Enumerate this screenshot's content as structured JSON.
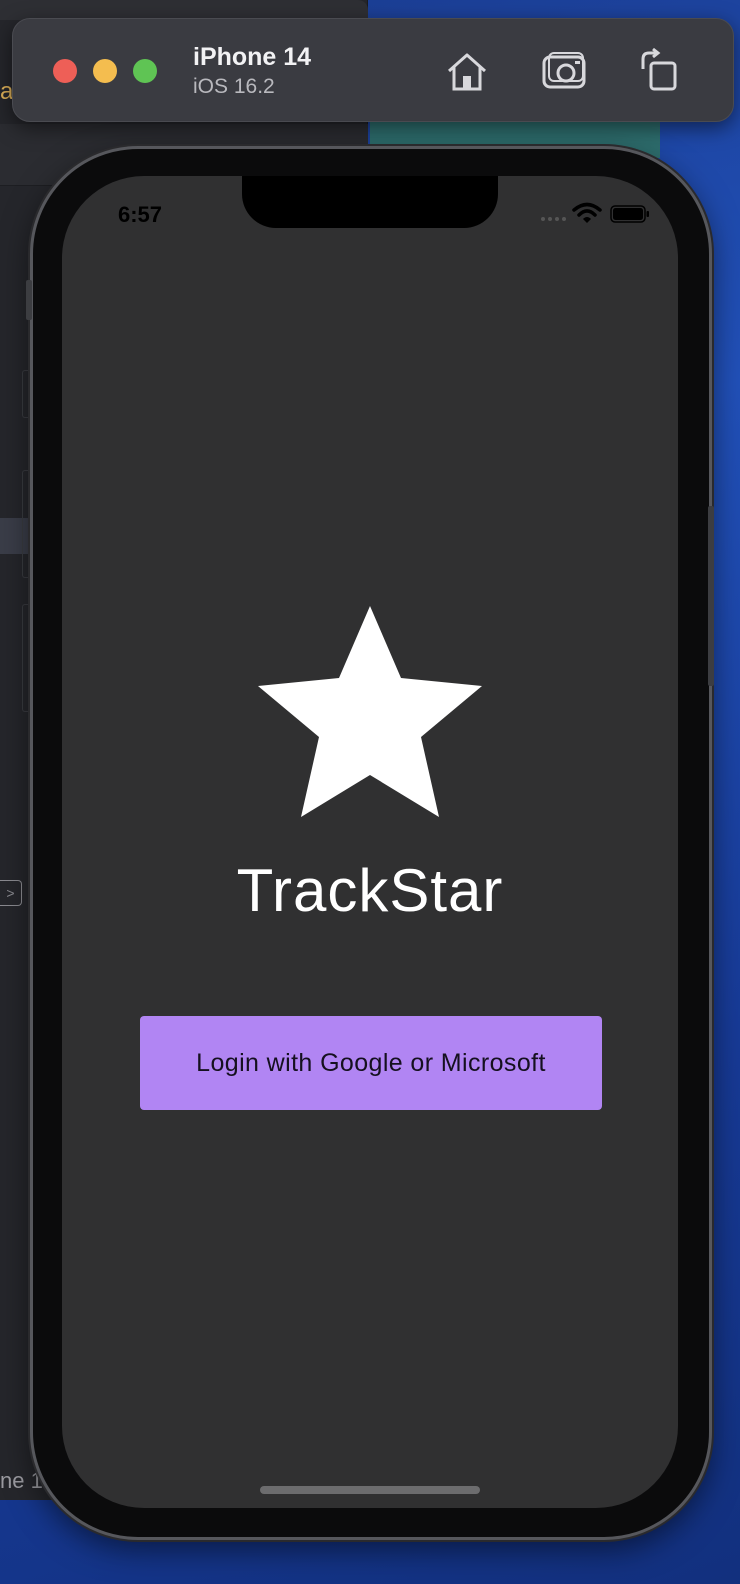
{
  "simulator": {
    "device_name": "iPhone 14",
    "os_version": "iOS 16.2",
    "tools": [
      "home-icon",
      "camera-icon",
      "rotate-icon"
    ]
  },
  "background": {
    "edge_text_top": "a",
    "edge_text_bottom": "ne 1"
  },
  "status_bar": {
    "time": "6:57"
  },
  "app": {
    "title": "TrackStar",
    "login_label": "Login with Google or Microsoft",
    "accent_color": "#b185f3",
    "background_color": "#303031"
  }
}
